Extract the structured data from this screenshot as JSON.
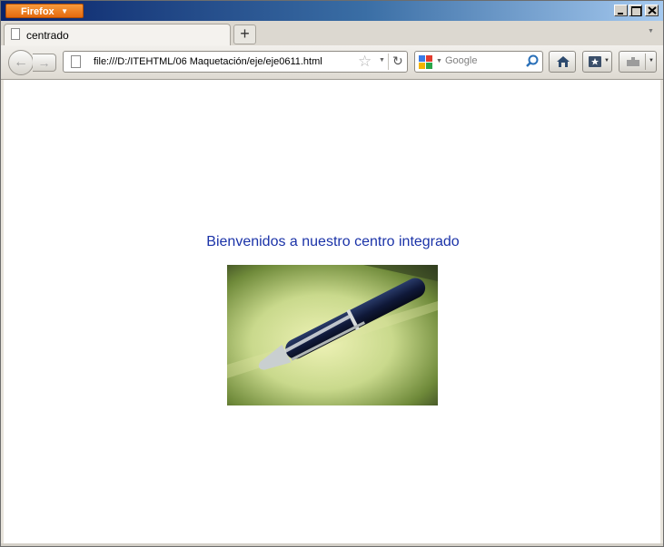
{
  "window": {
    "app_button_label": "Firefox",
    "controls": [
      "minimize",
      "maximize",
      "close"
    ]
  },
  "tabs": [
    {
      "label": "centrado",
      "active": true
    }
  ],
  "navbar": {
    "url": "file:///D:/ITEHTML/06 Maquetación/eje/eje0611.html",
    "search_placeholder": "Google"
  },
  "page": {
    "heading": "Bienvenidos a nuestro centro integrado",
    "heading_color": "#1b33a8"
  },
  "icons": {
    "back": "back-arrow-icon",
    "forward": "forward-arrow-icon",
    "bookmark_star": "star-icon",
    "reload": "reload-icon",
    "search_engine": "google-logo-icon",
    "search_go": "magnifier-icon",
    "home": "home-icon",
    "bookmarks": "bookmarks-icon",
    "addons": "puzzle-icon"
  }
}
